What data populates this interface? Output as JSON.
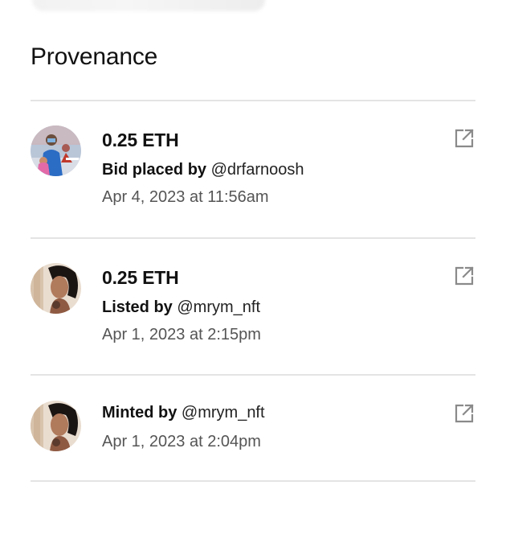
{
  "section": {
    "title": "Provenance"
  },
  "icons": {
    "external_link": "external-link-icon"
  },
  "colors": {
    "divider": "#e4e4e4",
    "secondary_text": "#555555",
    "icon": "#8a8a8a"
  },
  "events": [
    {
      "price": "0.25 ETH",
      "action": "Bid placed by",
      "user": "@drfarnoosh",
      "date": "Apr 4, 2023 at 11:56am",
      "avatar": "avatar-drfarnoosh"
    },
    {
      "price": "0.25 ETH",
      "action": "Listed by",
      "user": "@mrym_nft",
      "date": "Apr 1, 2023 at 2:15pm",
      "avatar": "avatar-mrym_nft"
    },
    {
      "action": "Minted by",
      "user": "@mrym_nft",
      "date": "Apr 1, 2023 at 2:04pm",
      "avatar": "avatar-mrym_nft"
    }
  ]
}
